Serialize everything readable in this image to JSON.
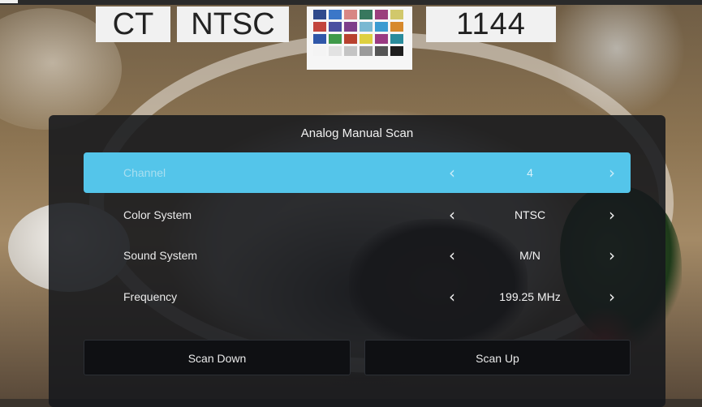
{
  "overlay": {
    "ct": "CT",
    "standard": "NTSC",
    "number": "1144",
    "swatch_colors": [
      "#2f4a8c",
      "#3b77c8",
      "#d88784",
      "#38785e",
      "#9b3f7e",
      "#d1c86b",
      "#c2453d",
      "#4a4fa0",
      "#7e3f8a",
      "#79b8d2",
      "#3a9bd1",
      "#d7892c",
      "#2f57a8",
      "#3f9a4a",
      "#b8412f",
      "#ded040",
      "#9a3a82",
      "#2a8c9c",
      "#f4f4f4",
      "#e2e2e2",
      "#c4c4c4",
      "#9a9a9a",
      "#555555",
      "#1e1e1e"
    ]
  },
  "menu": {
    "title": "Analog Manual Scan",
    "rows": [
      {
        "label": "Channel",
        "value": "4",
        "active": true
      },
      {
        "label": "Color System",
        "value": "NTSC",
        "active": false
      },
      {
        "label": "Sound System",
        "value": "M/N",
        "active": false
      },
      {
        "label": "Frequency",
        "value": "199.25 MHz",
        "active": false
      }
    ],
    "arrow_left": "‹",
    "arrow_right": "›",
    "scan_down_label": "Scan Down",
    "scan_up_label": "Scan Up",
    "accent_color": "#54c5ea"
  }
}
